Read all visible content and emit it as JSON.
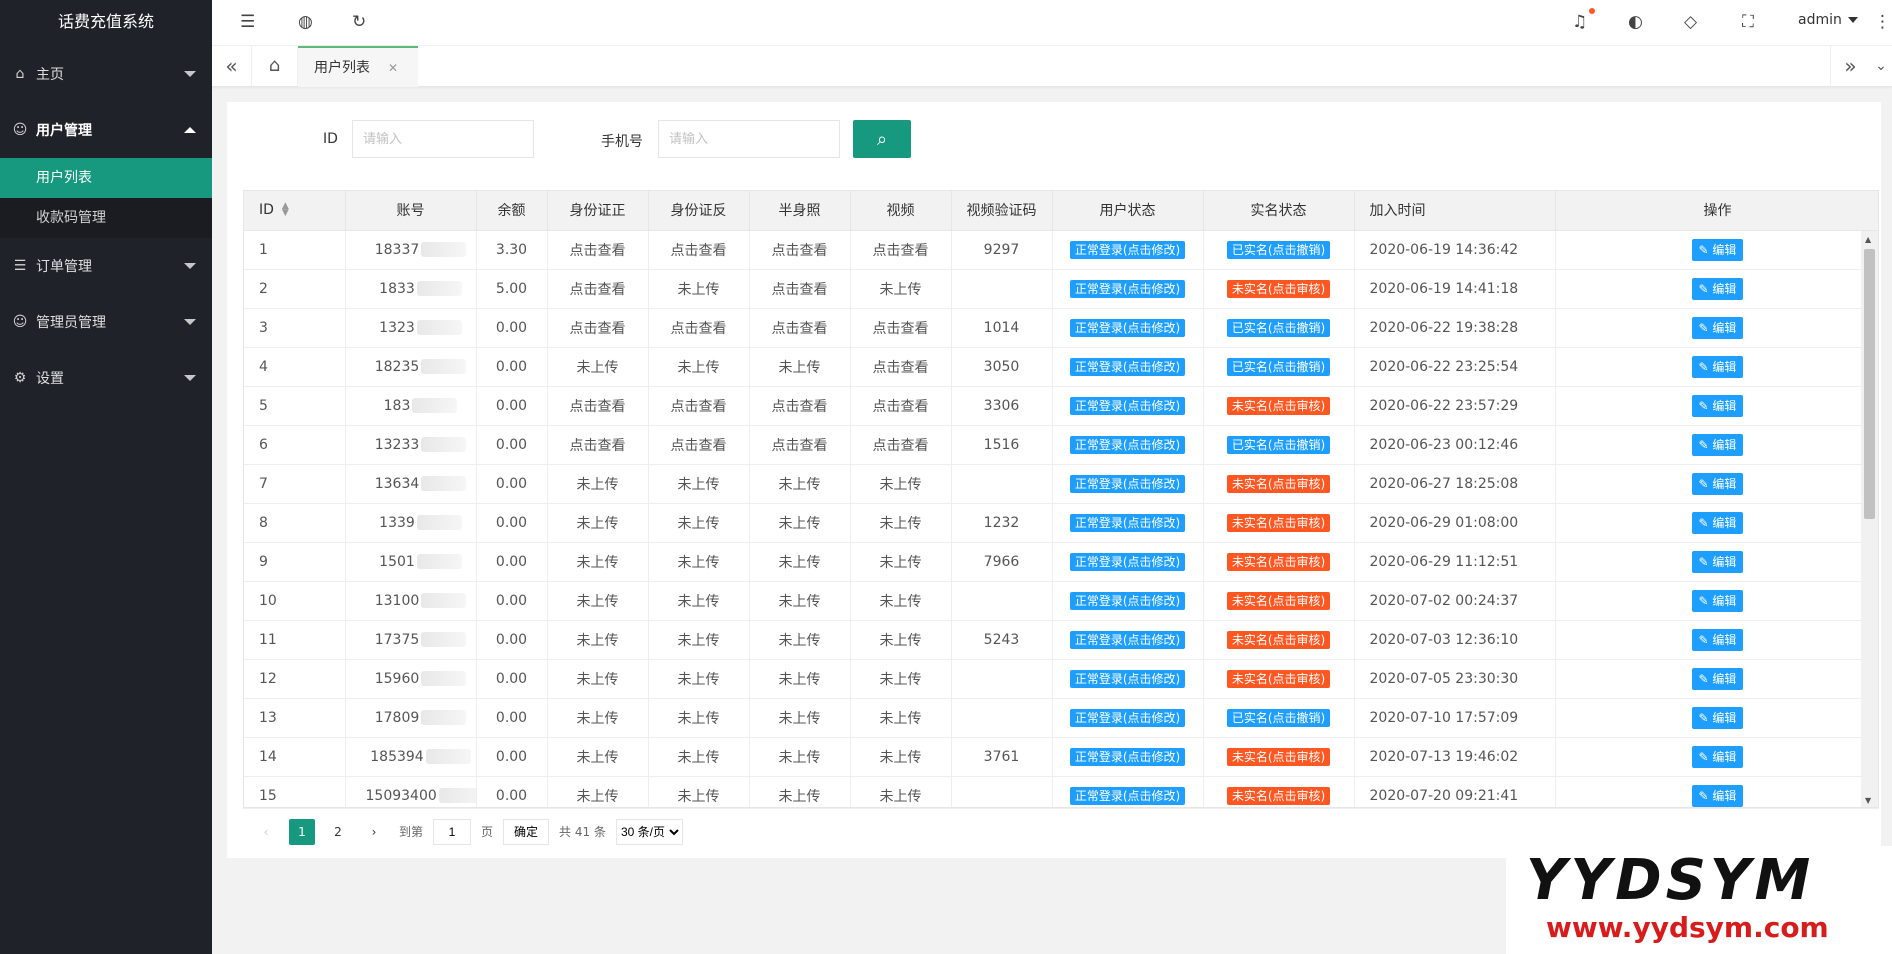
{
  "app": {
    "title": "话费充值系统"
  },
  "sidebar": {
    "items": [
      {
        "label": "主页",
        "icon": "home-icon"
      },
      {
        "label": "用户管理",
        "icon": "user-icon",
        "open": true,
        "children": [
          {
            "label": "用户列表",
            "active": true
          },
          {
            "label": "收款码管理"
          }
        ]
      },
      {
        "label": "订单管理",
        "icon": "list-icon"
      },
      {
        "label": "管理员管理",
        "icon": "user-icon"
      },
      {
        "label": "设置",
        "icon": "gear-icon"
      }
    ]
  },
  "header": {
    "user": "admin"
  },
  "tabs": {
    "current": "用户列表"
  },
  "search": {
    "id_label": "ID",
    "id_placeholder": "请输入",
    "phone_label": "手机号",
    "phone_placeholder": "请输入"
  },
  "table": {
    "columns": [
      "ID",
      "账号",
      "余额",
      "身份证正",
      "身份证反",
      "半身照",
      "视频",
      "视频验证码",
      "用户状态",
      "实名状态",
      "加入时间",
      "操作"
    ],
    "edit_label": "编辑",
    "rows": [
      [
        "1",
        "18337",
        "3.30",
        "点击查看",
        "点击查看",
        "点击查看",
        "点击查看",
        "9297",
        "正常登录(点击修改)",
        "已实名(点击撤销)",
        "2020-06-19 14:36:42"
      ],
      [
        "2",
        "1833",
        "5.00",
        "点击查看",
        "未上传",
        "点击查看",
        "未上传",
        "",
        "正常登录(点击修改)",
        "未实名(点击审核)",
        "2020-06-19 14:41:18"
      ],
      [
        "3",
        "1323",
        "0.00",
        "点击查看",
        "点击查看",
        "点击查看",
        "点击查看",
        "1014",
        "正常登录(点击修改)",
        "已实名(点击撤销)",
        "2020-06-22 19:38:28"
      ],
      [
        "4",
        "18235",
        "0.00",
        "未上传",
        "未上传",
        "未上传",
        "点击查看",
        "3050",
        "正常登录(点击修改)",
        "已实名(点击撤销)",
        "2020-06-22 23:25:54"
      ],
      [
        "5",
        "183",
        "0.00",
        "点击查看",
        "点击查看",
        "点击查看",
        "点击查看",
        "3306",
        "正常登录(点击修改)",
        "未实名(点击审核)",
        "2020-06-22 23:57:29"
      ],
      [
        "6",
        "13233",
        "0.00",
        "点击查看",
        "点击查看",
        "点击查看",
        "点击查看",
        "1516",
        "正常登录(点击修改)",
        "已实名(点击撤销)",
        "2020-06-23 00:12:46"
      ],
      [
        "7",
        "13634",
        "0.00",
        "未上传",
        "未上传",
        "未上传",
        "未上传",
        "",
        "正常登录(点击修改)",
        "未实名(点击审核)",
        "2020-06-27 18:25:08"
      ],
      [
        "8",
        "1339",
        "0.00",
        "未上传",
        "未上传",
        "未上传",
        "未上传",
        "1232",
        "正常登录(点击修改)",
        "未实名(点击审核)",
        "2020-06-29 01:08:00"
      ],
      [
        "9",
        "1501",
        "0.00",
        "未上传",
        "未上传",
        "未上传",
        "未上传",
        "7966",
        "正常登录(点击修改)",
        "未实名(点击审核)",
        "2020-06-29 11:12:51"
      ],
      [
        "10",
        "13100",
        "0.00",
        "未上传",
        "未上传",
        "未上传",
        "未上传",
        "",
        "正常登录(点击修改)",
        "未实名(点击审核)",
        "2020-07-02 00:24:37"
      ],
      [
        "11",
        "17375",
        "0.00",
        "未上传",
        "未上传",
        "未上传",
        "未上传",
        "5243",
        "正常登录(点击修改)",
        "未实名(点击审核)",
        "2020-07-03 12:36:10"
      ],
      [
        "12",
        "15960",
        "0.00",
        "未上传",
        "未上传",
        "未上传",
        "未上传",
        "",
        "正常登录(点击修改)",
        "未实名(点击审核)",
        "2020-07-05 23:30:30"
      ],
      [
        "13",
        "17809",
        "0.00",
        "未上传",
        "未上传",
        "未上传",
        "未上传",
        "",
        "正常登录(点击修改)",
        "已实名(点击撤销)",
        "2020-07-10 17:57:09"
      ],
      [
        "14",
        "185394",
        "0.00",
        "未上传",
        "未上传",
        "未上传",
        "未上传",
        "3761",
        "正常登录(点击修改)",
        "未实名(点击审核)",
        "2020-07-13 19:46:02"
      ],
      [
        "15",
        "15093400",
        "0.00",
        "未上传",
        "未上传",
        "未上传",
        "未上传",
        "",
        "正常登录(点击修改)",
        "未实名(点击审核)",
        "2020-07-20 09:21:41"
      ]
    ]
  },
  "pager": {
    "pages": [
      "1",
      "2"
    ],
    "current": "1",
    "goto_label": "到第",
    "goto_value": "1",
    "page_suffix": "页",
    "confirm": "确定",
    "total": "共 41 条",
    "per_page": "30 条/页"
  },
  "watermark": {
    "big": "YYDSYM",
    "small": "www.yydsym.com"
  },
  "colors": {
    "primary": "#16997e",
    "blue": "#1e9fff",
    "orange": "#ff5722",
    "sidebar": "#20222a"
  }
}
